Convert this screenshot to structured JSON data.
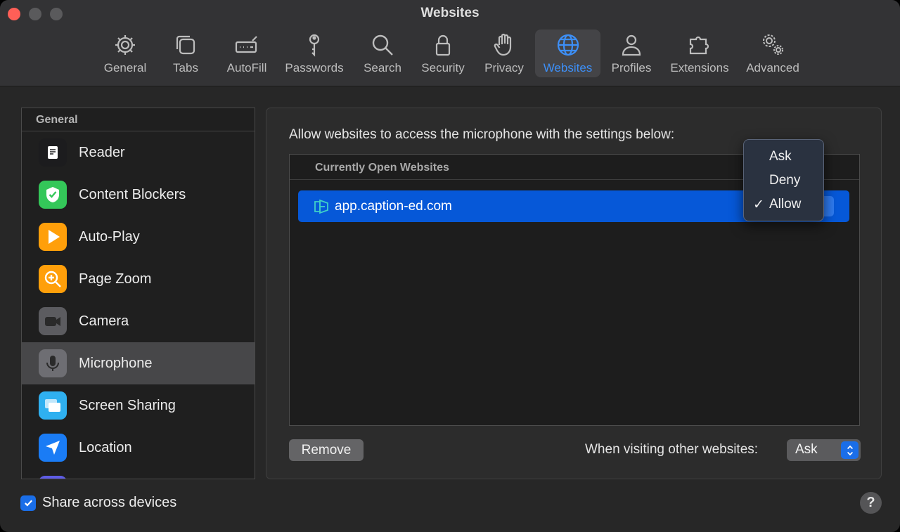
{
  "window": {
    "title": "Websites"
  },
  "toolbar": {
    "items": [
      {
        "label": "General",
        "icon": "gear-icon"
      },
      {
        "label": "Tabs",
        "icon": "tabs-icon"
      },
      {
        "label": "AutoFill",
        "icon": "autofill-icon"
      },
      {
        "label": "Passwords",
        "icon": "key-icon"
      },
      {
        "label": "Search",
        "icon": "search-icon"
      },
      {
        "label": "Security",
        "icon": "lock-icon"
      },
      {
        "label": "Privacy",
        "icon": "hand-icon"
      },
      {
        "label": "Websites",
        "icon": "globe-icon",
        "active": true
      },
      {
        "label": "Profiles",
        "icon": "person-icon"
      },
      {
        "label": "Extensions",
        "icon": "puzzle-icon"
      },
      {
        "label": "Advanced",
        "icon": "gears-icon"
      }
    ]
  },
  "sidebar": {
    "header": "General",
    "items": [
      {
        "label": "Reader",
        "icon": "reader-icon",
        "color": "#1c1c1e"
      },
      {
        "label": "Content Blockers",
        "icon": "shield-check-icon",
        "color": "#34c759"
      },
      {
        "label": "Auto-Play",
        "icon": "play-icon",
        "color": "#ff9f0a"
      },
      {
        "label": "Page Zoom",
        "icon": "zoom-icon",
        "color": "#ff9f0a"
      },
      {
        "label": "Camera",
        "icon": "camera-icon",
        "color": "#5c5c60"
      },
      {
        "label": "Microphone",
        "icon": "microphone-icon",
        "color": "#6e6e73",
        "selected": true
      },
      {
        "label": "Screen Sharing",
        "icon": "screen-sharing-icon",
        "color": "#2fb0f0"
      },
      {
        "label": "Location",
        "icon": "location-icon",
        "color": "#1a7cf5"
      }
    ]
  },
  "main": {
    "description": "Allow websites to access the microphone with the settings below:",
    "table": {
      "section_header": "Currently Open Websites",
      "rows": [
        {
          "site": "app.caption-ed.com",
          "value": "Allow"
        }
      ]
    },
    "remove_label": "Remove",
    "other_websites_label": "When visiting other websites:",
    "other_websites_value": "Ask"
  },
  "dropdown": {
    "options": [
      "Ask",
      "Deny",
      "Allow"
    ],
    "checkmark": "✓",
    "selected": "Allow"
  },
  "footer": {
    "share_label": "Share across devices",
    "share_checked": true,
    "help_label": "?"
  },
  "colors": {
    "accent": "#0658d8",
    "active_tab_label": "#3d8ff7"
  }
}
